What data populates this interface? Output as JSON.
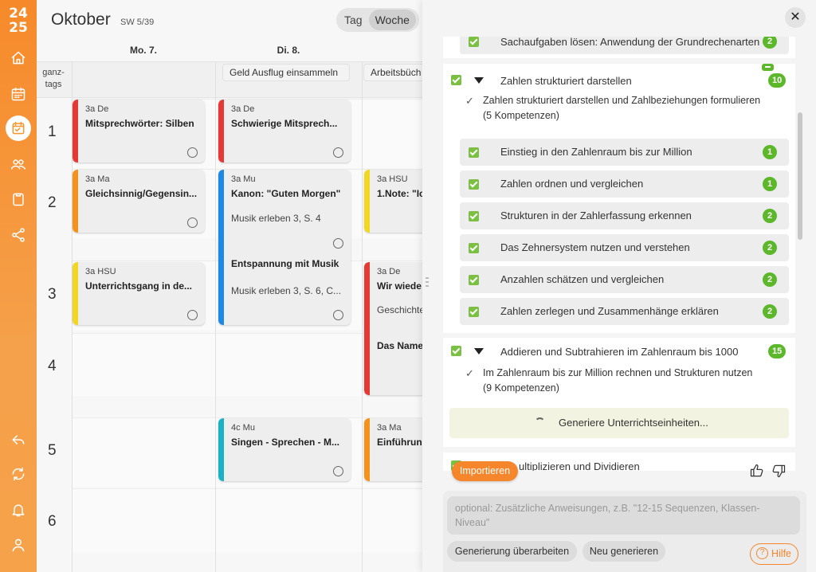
{
  "sidebar": {
    "year_top": "24",
    "year_bottom": "25",
    "icons": [
      "home-icon",
      "calendar-icon",
      "planner-icon",
      "group-icon",
      "clipboard-icon",
      "share-icon",
      "back-icon",
      "sync-icon",
      "bell-icon",
      "user-icon"
    ]
  },
  "calendar": {
    "month": "Oktober",
    "week": "SW 5/39",
    "view_tag": "Tag",
    "view_woche": "Woche",
    "days": [
      "Mo. 7.",
      "Di. 8."
    ],
    "allday_label_1": "ganz-",
    "allday_label_2": "tags",
    "allday_items": [
      "Geld Ausflug einsammeln",
      "Arbeitsbüch"
    ],
    "periods": [
      "1",
      "2",
      "3",
      "4",
      "5",
      "6"
    ],
    "cards": [
      {
        "cls": "3a De",
        "title": "Mitsprechwörter: Silben",
        "color": "#e53935"
      },
      {
        "cls": "3a Ma",
        "title": "Gleichsinnig/Gegensin...",
        "color": "#f5921e"
      },
      {
        "cls": "3a HSU",
        "title": "Unterrichtsgang in de...",
        "color": "#f2d722"
      },
      {
        "cls": "3a De",
        "title": "Schwierige Mitsprech...",
        "color": "#e53935"
      },
      {
        "cls": "3a Mu",
        "title": "Kanon: \"Guten Morgen\"",
        "sub": "Musik erleben 3, S. 4",
        "title2": "Entspannung mit Musik",
        "sub2": "Musik erleben 3, S. 6, C...",
        "color": "#1e88e5"
      },
      {
        "cls": "4c Mu",
        "title": "Singen - Sprechen - M...",
        "color": "#1ab0c6"
      },
      {
        "cls": "3a HSU",
        "title": "1.Note: \"Ic",
        "color": "#f2d722"
      },
      {
        "cls": "3a De",
        "title": "Wir wiede",
        "sub": "Geschichte",
        "title2": "Das Name",
        "color": "#e53935"
      },
      {
        "cls": "3a Ma",
        "title": "Einführun",
        "color": "#f5921e"
      }
    ]
  },
  "panel": {
    "top_item": "Sachaufgaben lösen: Anwendung der Grundrechenarten",
    "top_badge": "2",
    "section1": {
      "title": "Zahlen strukturiert darstellen",
      "badge": "10",
      "desc": "Zahlen strukturiert darstellen und Zahlbeziehungen formulieren",
      "count": "(5 Kompetenzen)",
      "items": [
        {
          "label": "Einstieg in den Zahlenraum bis zur Million",
          "badge": "1"
        },
        {
          "label": "Zahlen ordnen und vergleichen",
          "badge": "1"
        },
        {
          "label": "Strukturen in der Zahlerfassung erkennen",
          "badge": "2"
        },
        {
          "label": "Das Zehnersystem nutzen und verstehen",
          "badge": "2"
        },
        {
          "label": "Anzahlen schätzen und vergleichen",
          "badge": "2"
        },
        {
          "label": "Zahlen zerlegen und Zusammenhänge erklären",
          "badge": "2"
        }
      ]
    },
    "section2": {
      "title": "Addieren und Subtrahieren im Zahlenraum bis 1000",
      "badge": "15",
      "desc": "Im Zahlenraum bis zur Million rechnen und Strukturen nutzen",
      "count": "(9 Kompetenzen)",
      "generating": "Generiere Unterrichtseinheiten..."
    },
    "section3_partial": "ultiplizieren und Dividieren",
    "import_label": "Importieren",
    "prompt_placeholder": "optional: Zusätzliche Anweisungen, z.B. \"12-15 Sequenzen, Klassen-Niveau\"",
    "btn_rework": "Generierung überarbeiten",
    "btn_regen": "Neu generieren",
    "btn_help": "Hilfe",
    "colors": {
      "accent": "#f5862c",
      "badge": "#5cb82a",
      "checkbox": "#7bc043"
    }
  }
}
